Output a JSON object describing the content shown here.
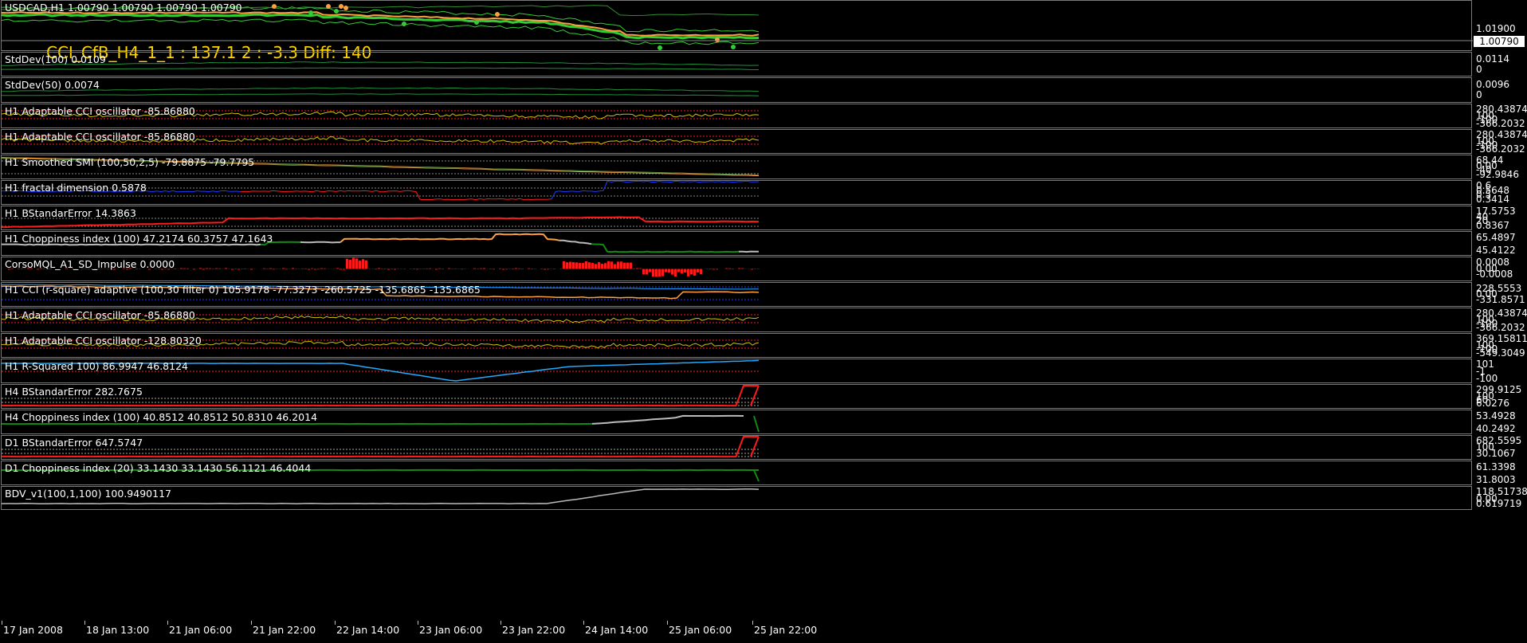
{
  "chart": {
    "symbol_line": "USDCAD,H1  1.00790 1.00790 1.00790 1.00790",
    "overlay_text": "CCI_CfB_H4_1_1 : 137.1 2 : -3.3 Diff: 140",
    "price_scale": [
      "1.01900"
    ],
    "current_price": "1.00790"
  },
  "colors": {
    "background": "#000000",
    "frame": "#7a7a7a",
    "bull_green": "#33cc33",
    "orange": "#ffa040",
    "yellow_line": "#d4c000",
    "red": "#ff1a1a",
    "blue": "#1a3cff",
    "cyan": "#22aaff",
    "gray_line": "#bbbbbb",
    "dark_green": "#138a13",
    "overlay_text": "#ffd500"
  },
  "panes": [
    {
      "id": "stddev100",
      "label": "StdDev(100) 0.0109",
      "scale": [
        "0.0114",
        "0"
      ]
    },
    {
      "id": "stddev50",
      "label": "StdDev(50) 0.0074",
      "scale": [
        "0.0096",
        "0"
      ]
    },
    {
      "id": "adcci1",
      "label": "H1 Adaptable CCI oscillator -85.86880",
      "scale": [
        "280.43874",
        "100",
        "-100",
        "-366.2032"
      ]
    },
    {
      "id": "adcci2",
      "label": "H1 Adaptable CCI oscillator -85.86880",
      "scale": [
        "280.43874",
        "100",
        "-100",
        "-366.2032"
      ]
    },
    {
      "id": "smi",
      "label": "H1 Smoothed SMI (100,50,2,5) -79.8875 -79.7795",
      "scale": [
        "68.44",
        "0.00",
        "-40",
        "-92.9846"
      ]
    },
    {
      "id": "fractal",
      "label": "H1 fractal dimension 0.5878",
      "scale": [
        "0.6",
        "0.5648",
        "0.5",
        "0.3414"
      ]
    },
    {
      "id": "bse1",
      "label": "H1 BStandarError 14.3863",
      "scale": [
        "17.5753",
        "40",
        "20",
        "0.8367"
      ]
    },
    {
      "id": "chop1",
      "label": "H1 Choppiness index (100) 47.2174 60.3757 47.1643",
      "scale": [
        "65.4897",
        "45.4122"
      ]
    },
    {
      "id": "corso",
      "label": "CorsoMQL_A1_SD_Impulse 0.0000",
      "scale": [
        "0.0008",
        "0.00",
        "-0.0008"
      ]
    },
    {
      "id": "ccirsq",
      "label": "H1 CCI (r-square) adaptive (100,30 filter 0) 105.9178 -77.3273 -260.5725 -135.6865 -135.6865",
      "scale": [
        "228.5553",
        "0.00",
        "-331.8571"
      ]
    },
    {
      "id": "adcci3",
      "label": "H1 Adaptable CCI oscillator -85.86880",
      "scale": [
        "280.43874",
        "100",
        "-100",
        "-366.2032"
      ]
    },
    {
      "id": "adcci4",
      "label": "H1 Adaptable CCI oscillator -128.80320",
      "scale": [
        "369.15811",
        "100",
        "-100",
        "-549.3049"
      ]
    },
    {
      "id": "rsq",
      "label": "H1 R-Squared 100) 86.9947 46.8124",
      "scale": [
        "101",
        "-1",
        "-100"
      ]
    },
    {
      "id": "bse4",
      "label": "H4 BStandarError 282.7675",
      "scale": [
        "299.9125",
        "100",
        "60",
        "6.0276"
      ]
    },
    {
      "id": "chop4",
      "label": "H4 Choppiness index (100) 40.8512 40.8512 50.8310 46.2014",
      "scale": [
        "53.4928",
        "40.2492"
      ]
    },
    {
      "id": "bsed1",
      "label": "D1 BStandarError 647.5747",
      "scale": [
        "682.5595",
        "100",
        "30.1067"
      ]
    },
    {
      "id": "chopd1",
      "label": "D1 Choppiness index (20) 33.1430 33.1430 56.1121 46.4044",
      "scale": [
        "61.3398",
        "31.8003"
      ]
    },
    {
      "id": "bdv",
      "label": "BDV_v1(100,1,100) 100.9490117",
      "scale": [
        "118.51738",
        "0.00",
        "0.619719"
      ]
    }
  ],
  "time_axis": [
    "17 Jan 2008",
    "18 Jan 13:00",
    "21 Jan 06:00",
    "21 Jan 22:00",
    "22 Jan 14:00",
    "23 Jan 06:00",
    "23 Jan 22:00",
    "24 Jan 14:00",
    "25 Jan 06:00",
    "25 Jan 22:00"
  ]
}
